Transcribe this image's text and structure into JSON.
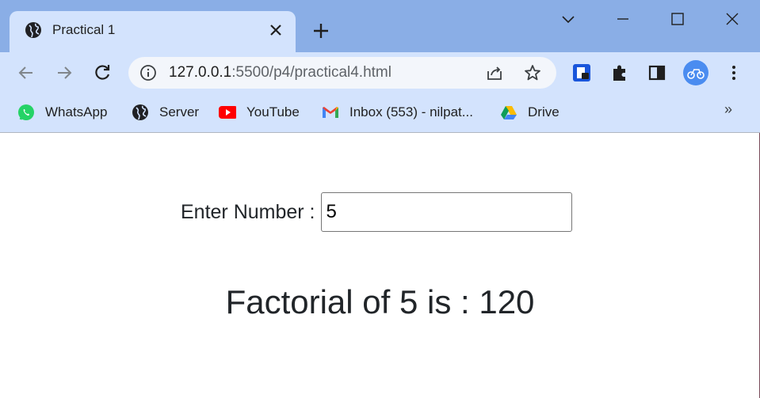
{
  "tab": {
    "title": "Practical 1",
    "favicon": "globe-icon",
    "close_icon": "close-icon"
  },
  "window_controls": [
    "minimize-icon",
    "maximize-icon",
    "close-icon"
  ],
  "toolbar": {
    "url_host": "127.0.0.1",
    "url_rest": ":5500/p4/practical4.html"
  },
  "bookmarks": [
    {
      "label": "WhatsApp",
      "icon": "whatsapp-icon"
    },
    {
      "label": "Server",
      "icon": "globe-icon"
    },
    {
      "label": "YouTube",
      "icon": "youtube-icon"
    },
    {
      "label": "Inbox (553) - nilpat...",
      "icon": "gmail-icon"
    },
    {
      "label": "Drive",
      "icon": "drive-icon"
    }
  ],
  "page": {
    "input_label": "Enter Number :",
    "input_value": "5",
    "result_text": "Factorial of 5 is : 120"
  },
  "colors": {
    "titlebar": "#8aaee6",
    "toolbar": "#d3e3fd",
    "text": "#212529"
  }
}
